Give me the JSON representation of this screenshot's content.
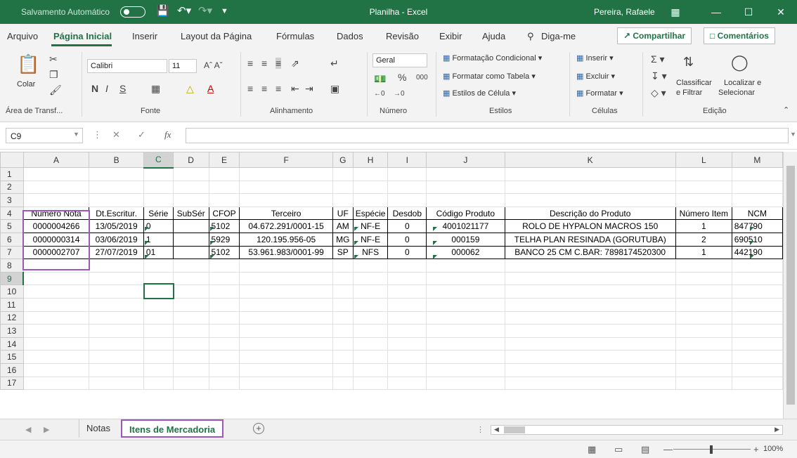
{
  "titlebar": {
    "autosave": "Salvamento Automático",
    "title": "Planilha  -  Excel",
    "user": "Pereira, Rafaele",
    "colors": {
      "bar": "#217346",
      "accent": "#9b59b6"
    }
  },
  "menu": {
    "items": [
      "Arquivo",
      "Página Inicial",
      "Inserir",
      "Layout da Página",
      "Fórmulas",
      "Dados",
      "Revisão",
      "Exibir",
      "Ajuda"
    ],
    "search": "Diga-me",
    "share": "Compartilhar",
    "comments": "Comentários"
  },
  "ribbon": {
    "paste": "Colar",
    "clipboard": "Área de Transf...",
    "font_name": "Calibri",
    "font_size": "11",
    "font_group": "Fonte",
    "align_group": "Alinhamento",
    "number_format": "Geral",
    "number_group": "Número",
    "cond_format": "Formatação Condicional",
    "format_table": "Formatar como Tabela",
    "cell_styles": "Estilos de Célula",
    "styles_group": "Estilos",
    "insert": "Inserir",
    "delete": "Excluir",
    "format": "Formatar",
    "cells_group": "Células",
    "sort_line1": "Classificar",
    "sort_line2": "e Filtrar",
    "find_line1": "Localizar e",
    "find_line2": "Selecionar",
    "edit_group": "Edição"
  },
  "formula": {
    "namebox": "C9",
    "fx": "fx"
  },
  "grid": {
    "columns": [
      "A",
      "B",
      "C",
      "D",
      "E",
      "F",
      "G",
      "H",
      "I",
      "J",
      "K",
      "L",
      "M"
    ],
    "rows": [
      "1",
      "2",
      "3",
      "4",
      "5",
      "6",
      "7",
      "8",
      "9",
      "10",
      "11",
      "12",
      "13",
      "14",
      "15",
      "16",
      "17"
    ],
    "headers": [
      "Número Nota",
      "Dt.Escritur.",
      "Série",
      "SubSér",
      "CFOP",
      "Terceiro",
      "UF",
      "Espécie",
      "Desdob",
      "Código Produto",
      "Descrição do Produto",
      "Número Item",
      "NCM"
    ],
    "data": [
      [
        "0000004266",
        "13/05/2019",
        "0",
        "",
        "5102",
        "04.672.291/0001-15",
        "AM",
        "NF-E",
        "0",
        "4001021177",
        "ROLO DE HYPALON MACROS 150",
        "1",
        "847790"
      ],
      [
        "0000000314",
        "03/06/2019",
        "1",
        "",
        "5929",
        "120.195.956-05",
        "MG",
        "NF-E",
        "0",
        "000159",
        "TELHA PLAN RESINADA (GORUTUBA)",
        "2",
        "690510"
      ],
      [
        "0000002707",
        "27/07/2019",
        "01",
        "",
        "5102",
        "53.961.983/0001-99",
        "SP",
        "NFS",
        "0",
        "000062",
        "BANCO 25 CM C.BAR: 7898174520300",
        "1",
        "442190"
      ]
    ]
  },
  "sheets": {
    "tabs": [
      "Notas",
      "Itens de Mercadoria"
    ],
    "active": "Itens de Mercadoria"
  },
  "status": {
    "zoom": "100%"
  }
}
